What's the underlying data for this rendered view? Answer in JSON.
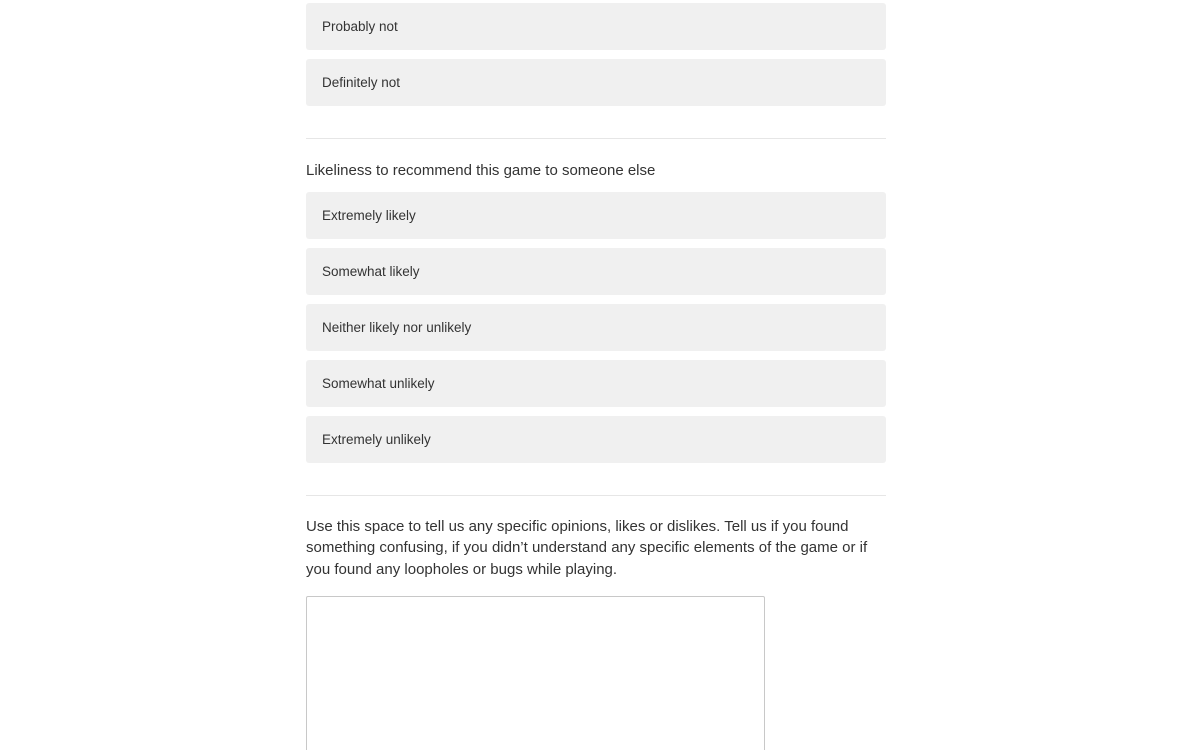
{
  "question_prev": {
    "options": [
      "Probably not",
      "Definitely not"
    ]
  },
  "question_recommend": {
    "label": "Likeliness to recommend this game to someone else",
    "options": [
      "Extremely likely",
      "Somewhat likely",
      "Neither likely nor unlikely",
      "Somewhat unlikely",
      "Extremely unlikely"
    ]
  },
  "question_feedback": {
    "label": "Use this space to tell us any specific opinions, likes or dislikes. Tell us if you found something confusing, if you didn’t understand any specific elements of the game or if you found any loopholes or bugs while playing.",
    "value": ""
  }
}
